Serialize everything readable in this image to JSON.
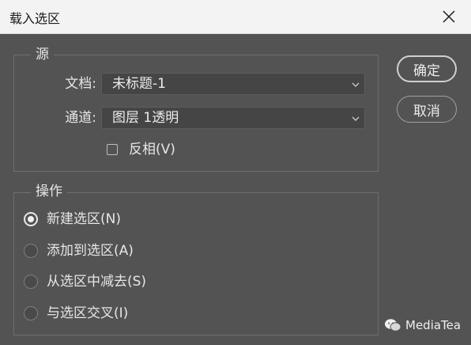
{
  "window": {
    "title": "载入选区"
  },
  "source": {
    "legend": "源",
    "document_label": "文档:",
    "document_value": "未标题-1",
    "channel_label": "通道:",
    "channel_value": "图层 1透明",
    "invert_label": "反相(V)",
    "invert_checked": false
  },
  "operation": {
    "legend": "操作",
    "options": [
      {
        "label": "新建选区(N)",
        "selected": true
      },
      {
        "label": "添加到选区(A)",
        "selected": false
      },
      {
        "label": "从选区中减去(S)",
        "selected": false
      },
      {
        "label": "与选区交叉(I)",
        "selected": false
      }
    ]
  },
  "buttons": {
    "ok": "确定",
    "cancel": "取消"
  },
  "watermark": {
    "text": "MediaTea"
  },
  "icons": {
    "close": "close-icon",
    "dropdown": "chevron-down-icon",
    "watermark": "wechat-icon"
  },
  "colors": {
    "dialog_bg": "#535353",
    "titlebar_bg": "#f3f3f3",
    "field_bg": "#454545",
    "text": "#e6e6e6"
  }
}
